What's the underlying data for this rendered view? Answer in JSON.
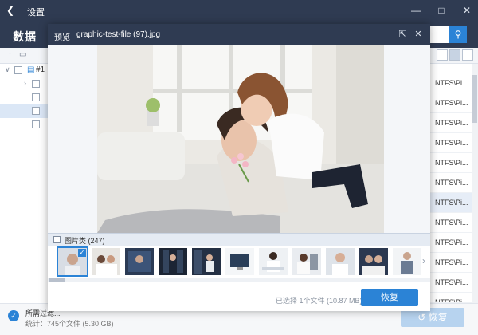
{
  "app": {
    "back_icon": "chevron-left-icon",
    "title": "设置",
    "logo": "數据",
    "search_icon": "search-icon"
  },
  "tree": {
    "root_label": "#1",
    "rows": [
      "",
      "",
      "",
      ""
    ]
  },
  "path_rows": [
    "NTFS\\Pi...",
    "NTFS\\Pi...",
    "NTFS\\Pi...",
    "NTFS\\Pi...",
    "NTFS\\Pi...",
    "NTFS\\Pi...",
    "NTFS\\Pi...",
    "NTFS\\Pi...",
    "NTFS\\Pi...",
    "NTFS\\Pi...",
    "NTFS\\Pi...",
    "NTFS\\Pi..."
  ],
  "footer": {
    "status_line1": "所需过滤...",
    "status_line2": "统计：745个文件 (5.30 GB)",
    "recover_label": "恢复"
  },
  "dialog": {
    "label": "预览",
    "filename": "graphic-test-file (97).jpg",
    "folder_label": "图片类 (247)",
    "selected_info": "已选择 1个文件 (10.87 MB)",
    "recover_label": "恢复",
    "thumbnails": [
      "t1",
      "t2",
      "t3",
      "t4",
      "t5",
      "t6",
      "t7",
      "t8",
      "t9",
      "t10",
      "t11",
      "t12"
    ]
  },
  "colors": {
    "titlebar": "#2f3b52",
    "accent": "#2b83d6"
  }
}
